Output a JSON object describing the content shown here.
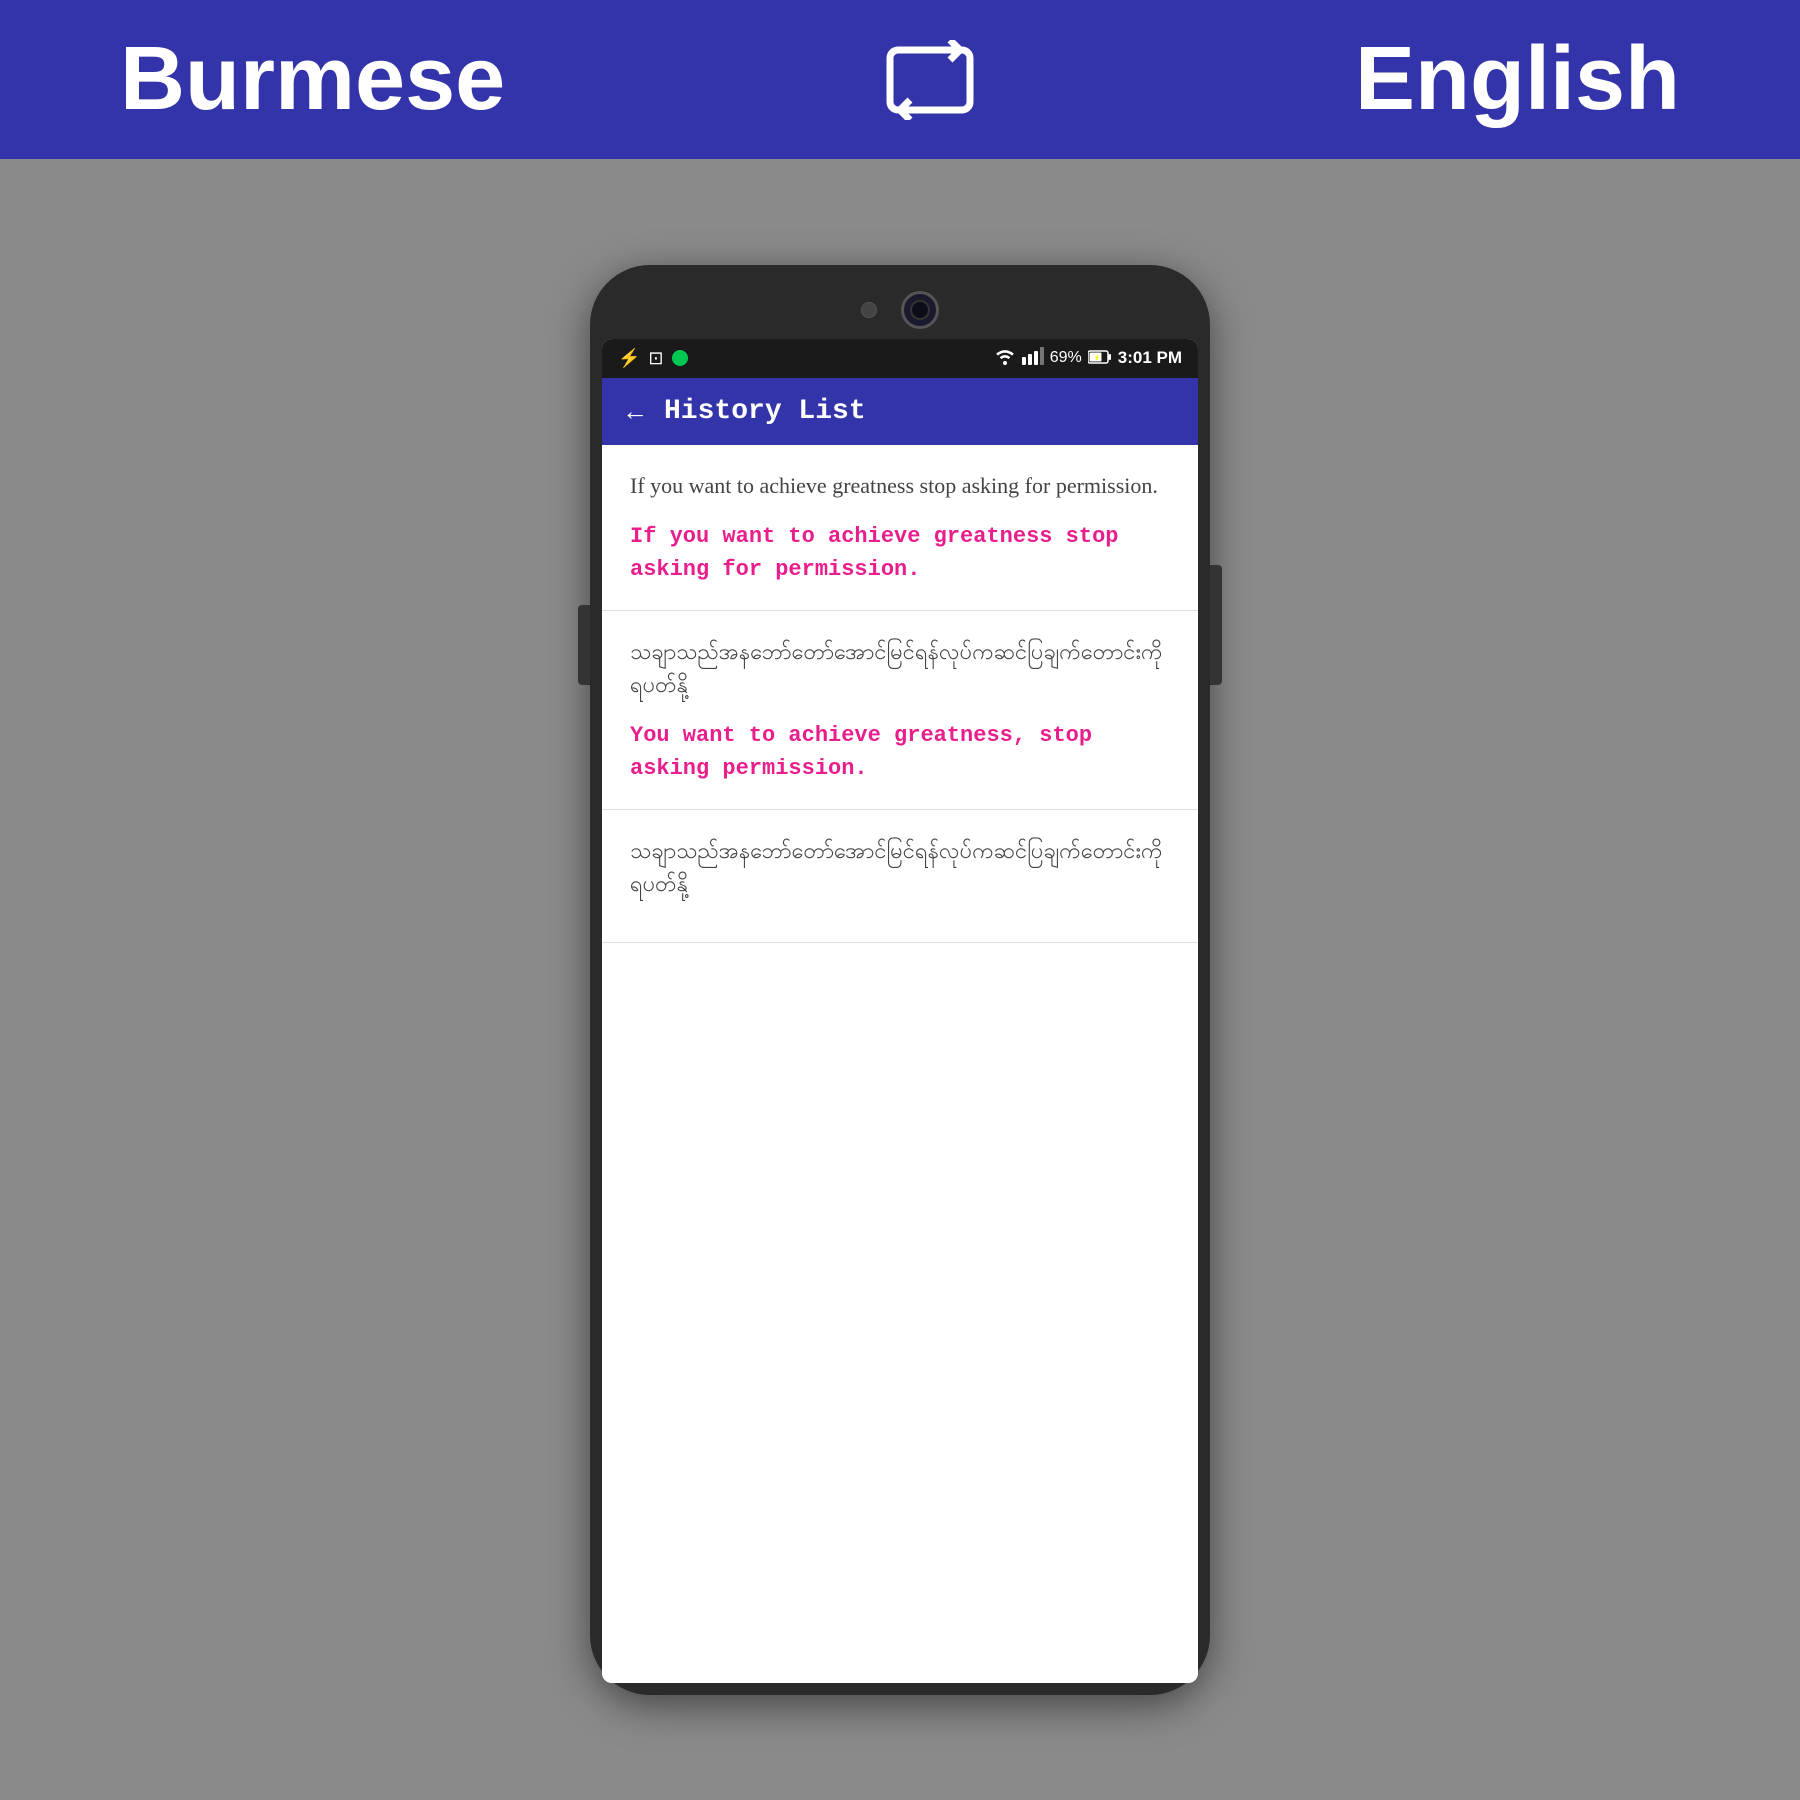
{
  "lang_bar": {
    "source_lang": "Burmese",
    "target_lang": "English",
    "swap_icon": "⇄"
  },
  "status_bar": {
    "time": "3:01 PM",
    "battery": "69%",
    "signal": "▌▌▌",
    "wifi": "wifi"
  },
  "app_bar": {
    "title": "History List",
    "back_label": "←"
  },
  "history_items": [
    {
      "id": 1,
      "source": "If you want to achieve greatness stop asking for permission.",
      "translated": "If you want to achieve greatness stop asking for permission.",
      "translated_color": "pink"
    },
    {
      "id": 2,
      "source": "သချာသည်အနဘော်တော်အောင်မြင်ရန်လုပ်ကခင်ပြချက်တောင်းကိုရပတ်နို့",
      "translated": "You want to achieve greatness, stop asking permission.",
      "translated_color": "pink"
    },
    {
      "id": 3,
      "source": "သချာသည်အနဘော်တော်အောင်မြင်ရန်လုပ်ကခင်ပြချက်တောင်းကိုရပတ်နို့",
      "translated": "",
      "translated_color": "none"
    }
  ]
}
